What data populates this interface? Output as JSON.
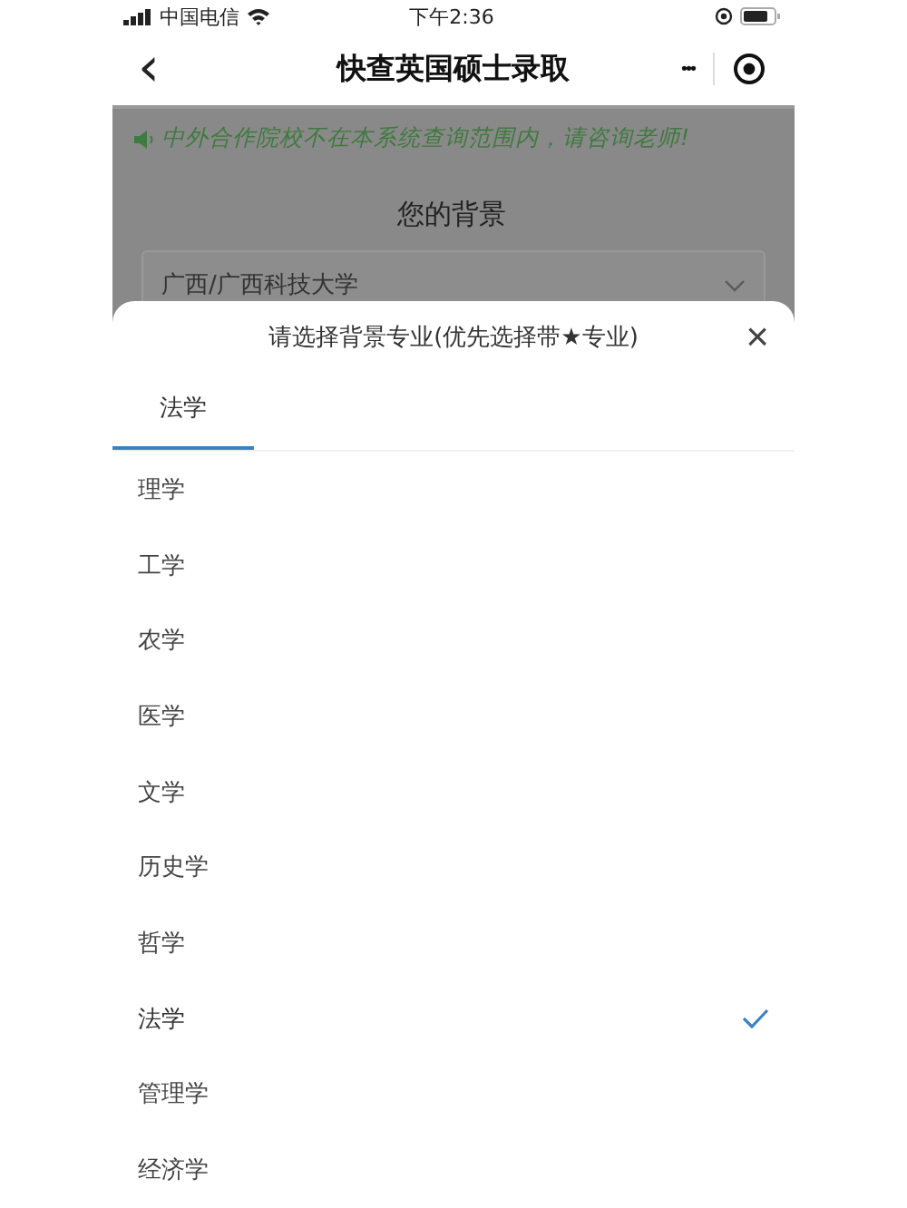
{
  "status_bar": {
    "carrier": "中国电信",
    "time": "下午2:36"
  },
  "nav": {
    "back": "‹",
    "title": "快查英国硕士录取",
    "more": "•••"
  },
  "notice": "中外合作院校不在本系统查询范围内，请咨询老师!",
  "section_title": "您的背景",
  "school_select": {
    "value": "广西/广西科技大学"
  },
  "sheet": {
    "title": "请选择背景专业(优先选择带★专业)",
    "close": "×",
    "tabs": [
      {
        "label": "法学",
        "selected": true
      }
    ],
    "options": [
      {
        "label": "理学",
        "selected": false
      },
      {
        "label": "工学",
        "selected": false
      },
      {
        "label": "农学",
        "selected": false
      },
      {
        "label": "医学",
        "selected": false
      },
      {
        "label": "文学",
        "selected": false
      },
      {
        "label": "历史学",
        "selected": false
      },
      {
        "label": "哲学",
        "selected": false
      },
      {
        "label": "法学",
        "selected": true
      },
      {
        "label": "管理学",
        "selected": false
      },
      {
        "label": "经济学",
        "selected": false
      }
    ]
  }
}
